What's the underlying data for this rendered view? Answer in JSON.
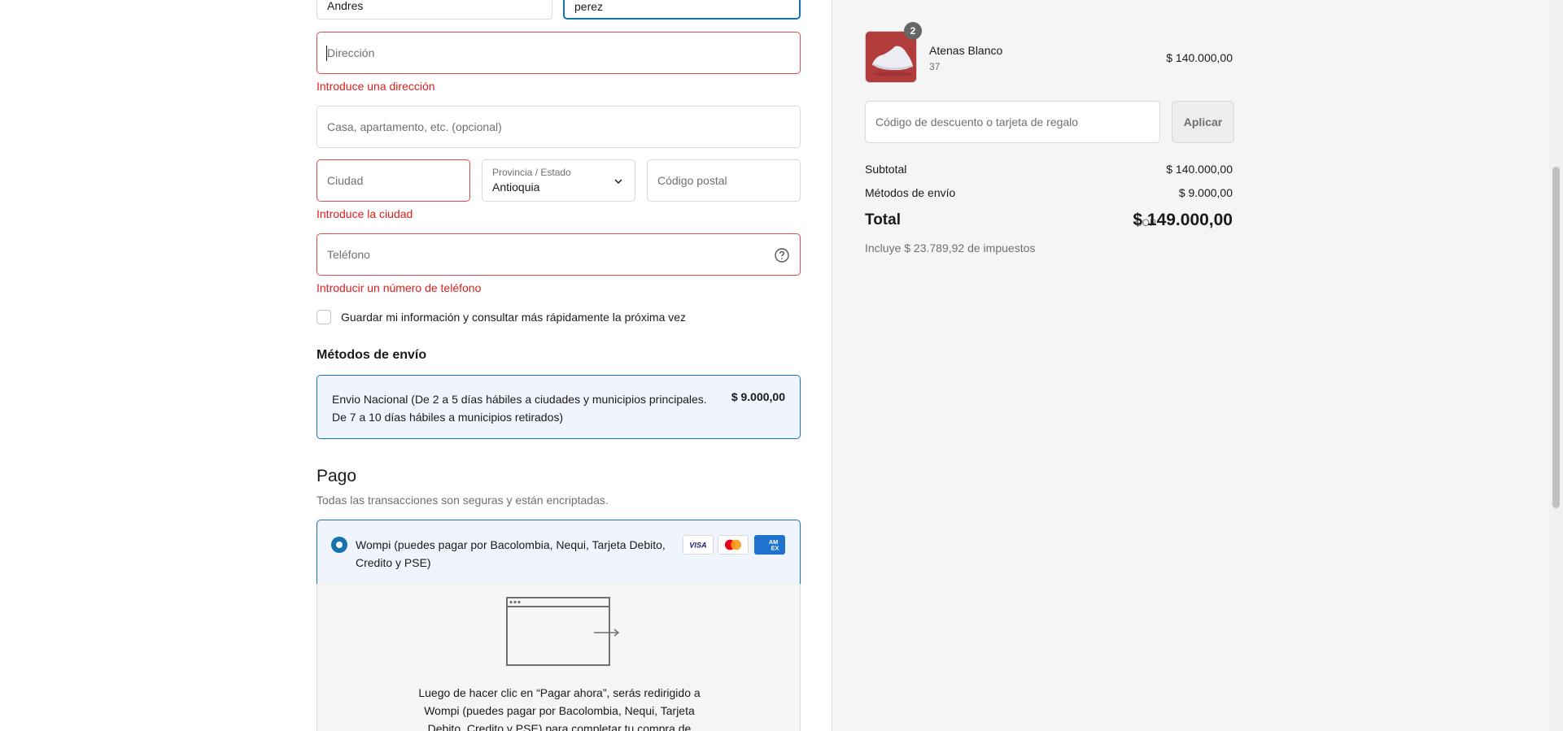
{
  "form": {
    "first_name_value": "Andres",
    "last_name_value": "perez",
    "address_placeholder": "Dirección",
    "address_error": "Introduce una dirección",
    "apartment_placeholder": "Casa, apartamento, etc. (opcional)",
    "city_placeholder": "Ciudad",
    "city_error": "Introduce la ciudad",
    "province_label": "Provincia / Estado",
    "province_value": "Antioquia",
    "postal_placeholder": "Código postal",
    "phone_placeholder": "Teléfono",
    "phone_error": "Introducir un número de teléfono",
    "save_info_label": "Guardar mi información y consultar más rápidamente la próxima vez"
  },
  "shipping": {
    "heading": "Métodos de envío",
    "option_desc": "Envio Nacional (De 2 a 5 días hábiles a ciudades y municipios principales. De 7 a 10 días hábiles a municipios retirados)",
    "option_price": "$ 9.000,00"
  },
  "payment": {
    "heading": "Pago",
    "subtitle": "Todas las transacciones son seguras y están encriptadas.",
    "option_label": "Wompi (puedes pagar por Bacolombia, Nequi, Tarjeta Debito, Credito y PSE)",
    "cards": [
      "VISA",
      "Mastercard",
      "AMEX"
    ],
    "redirect_text": "Luego de hacer clic en “Pagar ahora”, serás redirigido a Wompi (puedes pagar por Bacolombia, Nequi, Tarjeta Debito, Credito y PSE) para completar tu compra de"
  },
  "summary": {
    "product_qty": "2",
    "product_name": "Atenas Blanco",
    "product_variant": "37",
    "product_price": "$ 140.000,00",
    "discount_placeholder": "Código de descuento o tarjeta de regalo",
    "apply_label": "Aplicar",
    "subtotal_label": "Subtotal",
    "subtotal_value": "$ 140.000,00",
    "shipping_label": "Métodos de envío",
    "shipping_value": "$ 9.000,00",
    "total_label": "Total",
    "total_currency": "COP",
    "total_value": "$ 149.000,00",
    "tax_note": "Incluye $ 23.789,92 de impuestos"
  },
  "colors": {
    "accent": "#1773b0",
    "error": "#dd1d1d",
    "sidebar_bg": "#f5f5f5"
  }
}
